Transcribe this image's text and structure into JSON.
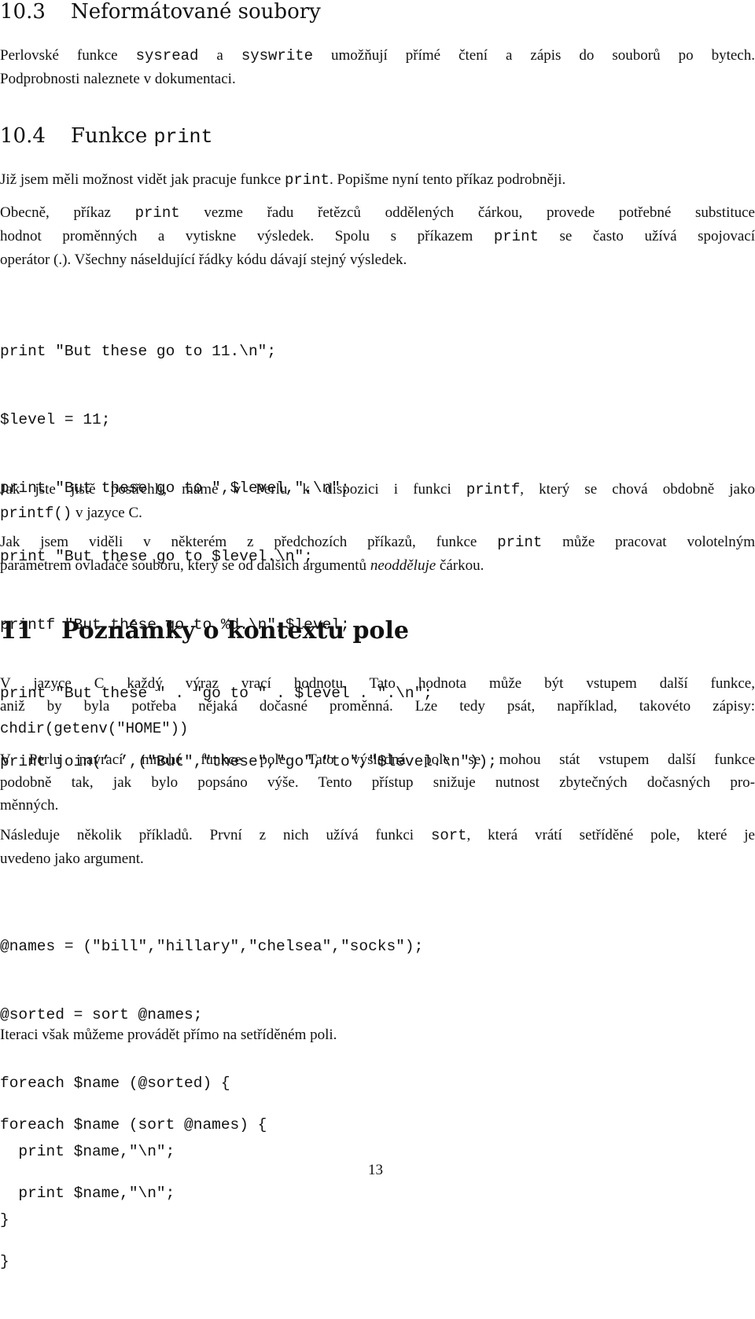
{
  "sections": {
    "s10_3": {
      "number": "10.3",
      "title": "Neformátované soubory"
    },
    "s10_4": {
      "number": "10.4",
      "title_prefix": "Funkce ",
      "title_code": "print"
    },
    "s11": {
      "number": "11",
      "title": "Poznámky o kontextu pole"
    }
  },
  "p1": {
    "l1a": "Perlovské funkce ",
    "l1code1": "sysread",
    "l1b": " a ",
    "l1code2": "syswrite",
    "l1c": " umožňují přímé čtení a zápis do souborů po bytech.",
    "l2": "Podprobnosti naleznete v dokumentaci."
  },
  "p2": {
    "a": "Již jsem měli možnost vidět jak pracuje funkce ",
    "code": "print",
    "b": ". Popišme nyní tento příkaz podrobněji."
  },
  "p3": {
    "l1a": "Obecně, příkaz ",
    "l1code": "print",
    "l1b": " vezme řadu řetězců oddělených čárkou, provede potřebné substituce",
    "l2a": "hodnot proměnných a vytiskne výsledek. Spolu s příkazem ",
    "l2code": "print",
    "l2b": " se často užívá spojovací",
    "l3": "operátor (.). Všechny náseldující řádky kódu dávají stejný výsledek."
  },
  "code1": [
    "print \"But these go to 11.\\n\";",
    "$level = 11;",
    "print \"But these go to \",$level,\".\\n\";",
    "print \"But these go to $level.\\n\";",
    "printf \"But these go to %d.\\n\",$level;",
    "print \"But these \" . \"go to \" . $level . \".\\n\";",
    "print join(’ ’,(\"But\",\"these\",\"go\",\"to\",\"$level.\\n\"));"
  ],
  "p4": {
    "l1a": "Jak jste jistě postřehli, máme v Perlu k dispozici i funkci ",
    "l1code": "printf",
    "l1b": ", který se chová obdobně jako",
    "l2code": "printf()",
    "l2b": " v jazyce C."
  },
  "p5": {
    "l1a": "Jak jsem viděli v některém z předchozích příkazů, funkce ",
    "l1code": "print",
    "l1b": " může pracovat volotelným",
    "l2a": "parametrem ovladače souboru, který se od dalších argumentů ",
    "l2em": "neodděluje",
    "l2b": " čárkou."
  },
  "p6": {
    "l1": "V jazyce C každý výraz vrací hodnotu. Tato hodnota může být vstupem další funkce,",
    "l2": "aniž by byla potřeba nějaká dočasné proměnná. Lze tedy psát, například, takovéto zápisy:",
    "l3code": "chdir(getenv(\"HOME\"))"
  },
  "p7": {
    "l1": "V Perlu navrací mnohé funkce pole. Tato výsledná pole se mohou stát vstupem další funkce",
    "l2": "podobně tak, jak bylo popsáno výše. Tento přístup snižuje nutnost zbytečných dočasných pro-",
    "l3": "měnných."
  },
  "p8": {
    "l1a": "Následuje několik příkladů. První z nich užívá funkci ",
    "l1code": "sort",
    "l1b": ", která vrátí setříděné pole, které je",
    "l2": "uvedeno jako argument."
  },
  "code2": [
    "@names = (\"bill\",\"hillary\",\"chelsea\",\"socks\");",
    "@sorted = sort @names;",
    "foreach $name (@sorted) {",
    "  print $name,\"\\n\";",
    "}"
  ],
  "p9": "Iteraci však můžeme provádět přímo na setříděném poli.",
  "code3": [
    "foreach $name (sort @names) {",
    "  print $name,\"\\n\";",
    "}"
  ],
  "page_number": "13"
}
